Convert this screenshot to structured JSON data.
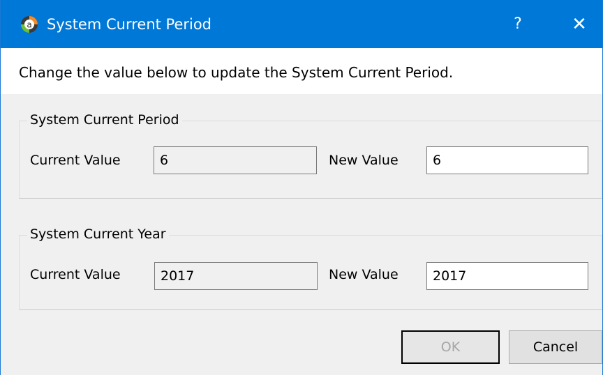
{
  "dialog": {
    "title": "System Current Period",
    "help_label": "?",
    "close_label": "✕",
    "app_icon_letter": "a",
    "instruction": "Change the value below to update the System Current Period."
  },
  "period_group": {
    "legend": "System Current Period",
    "current_label": "Current Value",
    "current_value": "6",
    "new_label": "New Value",
    "new_value": "6"
  },
  "year_group": {
    "legend": "System Current Year",
    "current_label": "Current Value",
    "current_value": "2017",
    "new_label": "New Value",
    "new_value": "2017"
  },
  "buttons": {
    "ok_label": "OK",
    "cancel_label": "Cancel"
  },
  "colors": {
    "titlebar": "#0078d7",
    "icon_accent": "#f28c28"
  }
}
